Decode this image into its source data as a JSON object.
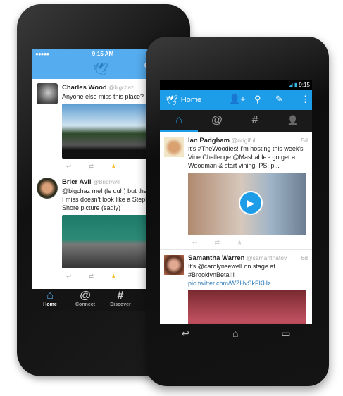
{
  "iphone": {
    "status": {
      "signal": "●●●●●",
      "time": "9:15 AM"
    },
    "tweets": [
      {
        "name": "Charles Wood",
        "handle": "@bigchaz",
        "lines": [
          "Anyone else miss this place?"
        ]
      },
      {
        "name": "Brier Avil",
        "handle": "@BrierAvil",
        "lines": [
          "@bigchaz me! (le duh) but the V",
          "I miss doesn't look like a Steph",
          "Shore picture (sadly)"
        ]
      }
    ],
    "tabs": [
      {
        "icon": "home-icon",
        "glyph": "⌂",
        "label": "Home"
      },
      {
        "icon": "at-icon",
        "glyph": "@",
        "label": "Connect"
      },
      {
        "icon": "hash-icon",
        "glyph": "#",
        "label": "Discover"
      }
    ]
  },
  "android": {
    "status": {
      "time": "9:15"
    },
    "action_bar": {
      "title": "Home"
    },
    "tabs": [
      {
        "icon": "home-icon",
        "glyph": "⌂"
      },
      {
        "icon": "at-icon",
        "glyph": "@"
      },
      {
        "icon": "hash-icon",
        "glyph": "#"
      },
      {
        "icon": "profile-icon",
        "glyph": "👤"
      }
    ],
    "tweets": [
      {
        "name": "Ian Padgham",
        "handle": "@origiful",
        "time": "5d",
        "text": "It's #TheWoodies! I'm hosting this week's Vine Challenge @Mashable - go get a Woodman & start vining! PS: p..."
      },
      {
        "name": "Samantha Warren",
        "handle": "@samanthatoy",
        "time": "6d",
        "text": "It's @carolynsewell on stage at #BrooklynBeta!!! ",
        "link": "pic.twitter.com/WZHvSkFKHz"
      }
    ]
  },
  "colors": {
    "twitter_blue": "#55acee",
    "android_blue": "#1d9ce8",
    "favorite": "#f5b80f"
  }
}
